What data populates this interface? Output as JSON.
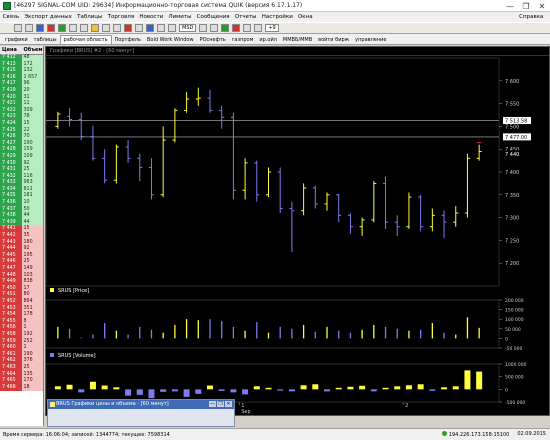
{
  "window": {
    "title": "[46297 SIGNAL-COM UID: 29634] Информационно-торговая система QUIK (версия 6.17.1.17)",
    "controls": [
      "—",
      "❐",
      "✕"
    ]
  },
  "menu": {
    "items": [
      "Связь",
      "Экспорт данных",
      "Таблицы",
      "Торговля",
      "Новости",
      "Лимиты",
      "Сообщения",
      "Отчеты",
      "Настройки",
      "Окна"
    ],
    "help": "Справка"
  },
  "toolbar": {
    "currency": "MSD",
    "step": "+9"
  },
  "tabs": [
    {
      "label": "графики",
      "active": false
    },
    {
      "label": "таблицы",
      "active": false
    },
    {
      "label": "рабочая область",
      "active": true
    },
    {
      "label": "Портфель",
      "active": false
    },
    {
      "label": "Bold Work Window",
      "active": false
    },
    {
      "label": "РОснефть",
      "active": false
    },
    {
      "label": "газпром",
      "active": false
    },
    {
      "label": "ир.ойл",
      "active": false
    },
    {
      "label": "ММВБ/ММВ",
      "active": false
    },
    {
      "label": "войти бирж",
      "active": false
    },
    {
      "label": "управление",
      "active": false
    }
  ],
  "orderbook": {
    "headers": [
      "Цена",
      "Объем"
    ],
    "sell": [
      {
        "price": "7 412",
        "vol": "48"
      },
      {
        "price": "7 413",
        "vol": "172"
      },
      {
        "price": "7 415",
        "vol": "132"
      },
      {
        "price": "7 416",
        "vol": "1 657"
      },
      {
        "price": "7 417",
        "vol": "96"
      },
      {
        "price": "7 419",
        "vol": "20"
      },
      {
        "price": "7 420",
        "vol": "31"
      },
      {
        "price": "7 421",
        "vol": "11"
      },
      {
        "price": "7 422",
        "vol": "309"
      },
      {
        "price": "7 423",
        "vol": "78"
      },
      {
        "price": "7 424",
        "vol": "15"
      },
      {
        "price": "7 425",
        "vol": "22"
      },
      {
        "price": "7 426",
        "vol": "70"
      },
      {
        "price": "7 427",
        "vol": "190"
      },
      {
        "price": "7 428",
        "vol": "159"
      },
      {
        "price": "7 429",
        "vol": "109"
      },
      {
        "price": "7 430",
        "vol": "92"
      },
      {
        "price": "7 431",
        "vol": "25"
      },
      {
        "price": "7 432",
        "vol": "116"
      },
      {
        "price": "7 433",
        "vol": "963"
      },
      {
        "price": "7 434",
        "vol": "811"
      },
      {
        "price": "7 435",
        "vol": "181"
      },
      {
        "price": "7 436",
        "vol": "10"
      },
      {
        "price": "7 437",
        "vol": "50"
      },
      {
        "price": "7 438",
        "vol": "44"
      },
      {
        "price": "7 439",
        "vol": "44"
      }
    ],
    "buy": [
      {
        "price": "7 441",
        "vol": "15"
      },
      {
        "price": "7 442",
        "vol": "35"
      },
      {
        "price": "7 443",
        "vol": "180"
      },
      {
        "price": "7 444",
        "vol": "92"
      },
      {
        "price": "7 445",
        "vol": "195"
      },
      {
        "price": "7 446",
        "vol": "25"
      },
      {
        "price": "7 447",
        "vol": "149"
      },
      {
        "price": "7 448",
        "vol": "103"
      },
      {
        "price": "7 449",
        "vol": "838"
      },
      {
        "price": "7 450",
        "vol": "17"
      },
      {
        "price": "7 451",
        "vol": "80"
      },
      {
        "price": "7 452",
        "vol": "864"
      },
      {
        "price": "7 453",
        "vol": "351"
      },
      {
        "price": "7 454",
        "vol": "178"
      },
      {
        "price": "7 455",
        "vol": "8"
      },
      {
        "price": "7 456",
        "vol": "1"
      },
      {
        "price": "7 458",
        "vol": "192"
      },
      {
        "price": "7 459",
        "vol": "252"
      },
      {
        "price": "7 460",
        "vol": "1"
      },
      {
        "price": "7 461",
        "vol": "190"
      },
      {
        "price": "7 462",
        "vol": "376"
      },
      {
        "price": "7 463",
        "vol": "25"
      },
      {
        "price": "7 464",
        "vol": "135"
      },
      {
        "price": "7 465",
        "vol": "170"
      },
      {
        "price": "7 466",
        "vol": "18"
      }
    ]
  },
  "chart_window": {
    "title": "Графики [BRUS] #2 - [60 минут]"
  },
  "chart_data": [
    {
      "type": "ohlc",
      "title": "SRUS [Price]",
      "ylim": [
        7150,
        7650
      ],
      "yticks": [
        "7 600",
        "7 550",
        "7 500",
        "7 450",
        "7 400",
        "7 350",
        "7 300",
        "7 250",
        "7 200"
      ],
      "hlines": [
        {
          "value": 7513,
          "label": "7 513.58"
        },
        {
          "value": 7477,
          "label": "7 477.00"
        },
        {
          "value": 7440,
          "label": "7 440"
        }
      ],
      "series": [
        {
          "o": 7500,
          "h": 7532,
          "l": 7495,
          "c": 7527
        },
        {
          "o": 7522,
          "h": 7540,
          "l": 7500,
          "c": 7515
        },
        {
          "o": 7515,
          "h": 7530,
          "l": 7470,
          "c": 7478
        },
        {
          "o": 7478,
          "h": 7502,
          "l": 7425,
          "c": 7430
        },
        {
          "o": 7430,
          "h": 7450,
          "l": 7375,
          "c": 7382
        },
        {
          "o": 7382,
          "h": 7460,
          "l": 7375,
          "c": 7455
        },
        {
          "o": 7455,
          "h": 7470,
          "l": 7420,
          "c": 7430
        },
        {
          "o": 7430,
          "h": 7440,
          "l": 7380,
          "c": 7410
        },
        {
          "o": 7410,
          "h": 7430,
          "l": 7340,
          "c": 7350
        },
        {
          "o": 7350,
          "h": 7500,
          "l": 7345,
          "c": 7470
        },
        {
          "o": 7470,
          "h": 7540,
          "l": 7465,
          "c": 7535
        },
        {
          "o": 7535,
          "h": 7575,
          "l": 7530,
          "c": 7560
        },
        {
          "o": 7560,
          "h": 7585,
          "l": 7545,
          "c": 7562
        },
        {
          "o": 7562,
          "h": 7580,
          "l": 7530,
          "c": 7535
        },
        {
          "o": 7535,
          "h": 7545,
          "l": 7495,
          "c": 7520
        },
        {
          "o": 7520,
          "h": 7530,
          "l": 7340,
          "c": 7360
        },
        {
          "o": 7360,
          "h": 7430,
          "l": 7340,
          "c": 7420
        },
        {
          "o": 7420,
          "h": 7425,
          "l": 7335,
          "c": 7350
        },
        {
          "o": 7350,
          "h": 7410,
          "l": 7345,
          "c": 7400
        },
        {
          "o": 7400,
          "h": 7410,
          "l": 7310,
          "c": 7320
        },
        {
          "o": 7320,
          "h": 7335,
          "l": 7225,
          "c": 7315
        },
        {
          "o": 7315,
          "h": 7375,
          "l": 7305,
          "c": 7365
        },
        {
          "o": 7365,
          "h": 7370,
          "l": 7320,
          "c": 7330
        },
        {
          "o": 7330,
          "h": 7355,
          "l": 7315,
          "c": 7350
        },
        {
          "o": 7350,
          "h": 7352,
          "l": 7290,
          "c": 7305
        },
        {
          "o": 7305,
          "h": 7310,
          "l": 7265,
          "c": 7280
        },
        {
          "o": 7280,
          "h": 7300,
          "l": 7260,
          "c": 7295
        },
        {
          "o": 7295,
          "h": 7380,
          "l": 7290,
          "c": 7375
        },
        {
          "o": 7375,
          "h": 7390,
          "l": 7275,
          "c": 7290
        },
        {
          "o": 7290,
          "h": 7305,
          "l": 7260,
          "c": 7280
        },
        {
          "o": 7280,
          "h": 7355,
          "l": 7275,
          "c": 7345
        },
        {
          "o": 7345,
          "h": 7350,
          "l": 7270,
          "c": 7280
        },
        {
          "o": 7280,
          "h": 7320,
          "l": 7270,
          "c": 7305
        },
        {
          "o": 7305,
          "h": 7315,
          "l": 7255,
          "c": 7290
        },
        {
          "o": 7290,
          "h": 7325,
          "l": 7280,
          "c": 7310
        },
        {
          "o": 7310,
          "h": 7440,
          "l": 7300,
          "c": 7430
        },
        {
          "o": 7430,
          "h": 7460,
          "l": 7425,
          "c": 7445
        }
      ]
    },
    {
      "type": "bar",
      "title": "SRUS [Volume]",
      "ylim": [
        -50000,
        200000
      ],
      "yticks": [
        "200 000",
        "150 000",
        "100 000",
        "50 000",
        "0",
        "-50 000"
      ],
      "values": [
        60000,
        50000,
        5000,
        20000,
        80000,
        40000,
        20000,
        60000,
        45000,
        30000,
        70000,
        100000,
        95000,
        100000,
        90000,
        60000,
        40000,
        85000,
        30000,
        60000,
        50000,
        70000,
        35000,
        60000,
        40000,
        30000,
        45000,
        70000,
        60000,
        50000,
        40000,
        45000,
        80000,
        30000,
        20000,
        110000,
        55000
      ]
    },
    {
      "type": "bar",
      "title": "",
      "ylim": [
        -500000,
        1000000
      ],
      "yticks": [
        "1000 000",
        "500 000",
        "0",
        "-500 000"
      ],
      "current_label": "1000 000",
      "values": [
        120000,
        180000,
        -120000,
        300000,
        150000,
        80000,
        -250000,
        -220000,
        -350000,
        -100000,
        -80000,
        -300000,
        -180000,
        150000,
        -60000,
        -120000,
        -200000,
        120000,
        60000,
        -50000,
        -80000,
        160000,
        200000,
        -80000,
        60000,
        100000,
        140000,
        -80000,
        60000,
        120000,
        160000,
        200000,
        -60000,
        80000,
        120000,
        750000,
        700000
      ]
    }
  ],
  "chart_axis": {
    "x_labels": [
      "1",
      "2"
    ],
    "date_label": "Sep"
  },
  "mini_window": {
    "title": "BRUS Графики цены и объема - [60 минут]"
  },
  "status": {
    "left": "Время сервера: 16:06:04; записей: 1344774; текущее: 7598314",
    "ip": "194.226.173.158:15100",
    "date": "02.09.2015"
  },
  "colors": {
    "bull": "#ffff3c",
    "bear": "#7c7cf0",
    "grid": "#3a3a3a",
    "hline": "#bdbdbd",
    "axisText": "#cfcfcf",
    "current": "#ff3030"
  }
}
